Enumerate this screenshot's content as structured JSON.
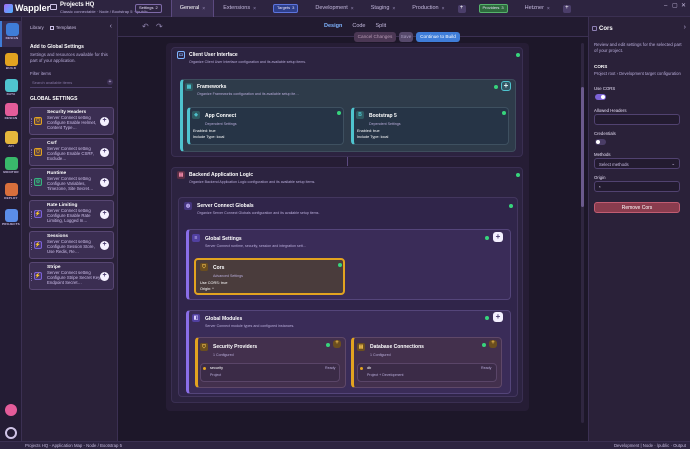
{
  "app": {
    "name": "Wappler"
  },
  "project": {
    "name": "Projects HQ",
    "subtitle": "Classic connectable · Node / Bootstrap 5 · /public"
  },
  "tabs": [
    {
      "label": "Settings",
      "badge": "2",
      "type": "pill"
    },
    {
      "label": "General",
      "active": true
    },
    {
      "label": "Extensions"
    },
    {
      "label": "Targets",
      "badge": "3",
      "type": "pill-blue"
    },
    {
      "label": "Development"
    },
    {
      "label": "Staging"
    },
    {
      "label": "Production"
    },
    {
      "label": "Providers",
      "badge": "3",
      "type": "pill-green"
    },
    {
      "label": "Hetzner"
    }
  ],
  "sidebar": [
    {
      "label": "DESIGN",
      "icon": "layout-icon",
      "color": "#3f7dd8"
    },
    {
      "label": "BUILD",
      "icon": "database-icon",
      "color": "#e2a320"
    },
    {
      "label": "DATA",
      "icon": "table-icon",
      "color": "#4fc4cf"
    },
    {
      "label": "DESIGN",
      "icon": "brain-icon",
      "color": "#e45c9a"
    },
    {
      "label": "API",
      "icon": "bolt-icon",
      "color": "#e6b73c"
    },
    {
      "label": "MONITOR",
      "icon": "chart-icon",
      "color": "#39b86b"
    },
    {
      "label": "DEPLOY",
      "icon": "cloud-icon",
      "color": "#d96f3c"
    },
    {
      "label": "PROJECTS",
      "icon": "bars-icon",
      "color": "#5b8de8"
    }
  ],
  "library": {
    "tab_library": "Library",
    "tab_templates": "Templates",
    "title": "Add to Global Settings",
    "desc": "Settings and resources available for this part of your application.",
    "filter_label": "Filter items",
    "filter_placeholder": "Search available items",
    "section": "GLOBAL SETTINGS",
    "section_badge": "+",
    "items": [
      {
        "title": "Security Headers",
        "desc": "Server Connect setting Configure Enable Helmet, Content Type…",
        "icon": "shield-icon",
        "color": "#e2a320",
        "glyph": "⛉"
      },
      {
        "title": "Csrf",
        "desc": "Server Connect setting Configure Enable CSRF, Exclude…",
        "icon": "shield-icon",
        "color": "#e2a320",
        "glyph": "⛉"
      },
      {
        "title": "Runtime",
        "desc": "Server Connect setting Configure Variables, Timezone, Site Secret…",
        "icon": "gear-icon",
        "color": "#36b37e",
        "glyph": "⚙"
      },
      {
        "title": "Rate Limiting",
        "desc": "Server Connect setting Configure Enable Rate Limiting, Logged In…",
        "icon": "bolt-icon",
        "color": "#7c62d6",
        "glyph": "⚡"
      },
      {
        "title": "Sessions",
        "desc": "Server Connect setting Configure Session Store, Use Redis, Re…",
        "icon": "bolt-icon",
        "color": "#7c62d6",
        "glyph": "⚡"
      },
      {
        "title": "Stripe",
        "desc": "Server Connect setting Configure Stripe Secret Key, Endpoint Secret…",
        "icon": "bolt-icon",
        "color": "#7c62d6",
        "glyph": "⚡"
      }
    ]
  },
  "toolbar": {
    "view_tabs": [
      {
        "label": "Design",
        "active": true
      },
      {
        "label": "Code"
      },
      {
        "label": "Split"
      }
    ],
    "cancel": "Cancel Changes",
    "save": "Save",
    "build": "Continue to Build"
  },
  "canvas": {
    "cui": {
      "title": "Client User Interface",
      "sub": "Organize Client User Interface configuration and its available setup items."
    },
    "frameworks": {
      "title": "Frameworks",
      "sub": "Organize Frameworks configuration and its available setup ite…"
    },
    "app_connect": {
      "title": "App Connect",
      "sub": "Dependent Settings",
      "l1": "Enabled: true",
      "l2": "Include Type: local"
    },
    "bootstrap": {
      "title": "Bootstrap 5",
      "sub": "Dependent Settings",
      "l1": "Enabled: true",
      "l2": "Include Type: local"
    },
    "bal": {
      "title": "Backend Application Logic",
      "sub": "Organize Backend Application Logic configuration and its available setup items."
    },
    "scg": {
      "title": "Server Connect Globals",
      "sub": "Organize Server Connect Globals configuration and its available setup items."
    },
    "gs": {
      "title": "Global Settings",
      "sub": "Server Connect runtime, security, session and integration sett…"
    },
    "cors": {
      "title": "Cors",
      "sub": "Advanced Settings",
      "l1": "Use CORS: true",
      "l2": "Origin: *"
    },
    "gm": {
      "title": "Global Modules",
      "sub": "Server Connect module types and configured instances."
    },
    "sp": {
      "title": "Security Providers",
      "sub": "1 Configured",
      "item": "security",
      "item_sub": "Project",
      "status": "Ready"
    },
    "dbc": {
      "title": "Database Connections",
      "sub": "1 Configured",
      "item": "db",
      "item_sub": "Project + Development",
      "status": "Ready"
    }
  },
  "panel": {
    "title": "Cors",
    "desc": "Review and edit settings for the selected part of your project.",
    "section": "CORS",
    "section_sub": "Project root › Development target configuration",
    "use_cors": "Use CORS",
    "use_cors_on": true,
    "allowed_headers": "Allowed Headers",
    "allowed_headers_value": "",
    "credentials": "Credentials",
    "credentials_on": false,
    "methods": "Methods",
    "methods_placeholder": "Select methods",
    "origin": "Origin",
    "origin_value": "*",
    "remove": "Remove Cors"
  },
  "status": {
    "left": "Projects HQ - Application Map - Node / Bootstrap 5",
    "right": "Development | Node · /public · Output"
  },
  "colors": {
    "accent": "#3f7dd8",
    "ok": "#37d47c",
    "amber": "#e2a320",
    "purple": "#7c62d6"
  }
}
